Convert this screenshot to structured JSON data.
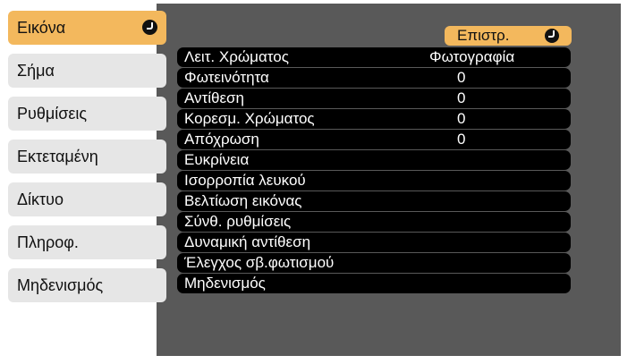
{
  "sidebar": {
    "items": [
      {
        "label": "Εικόνα",
        "active": true
      },
      {
        "label": "Σήμα"
      },
      {
        "label": "Ρυθμίσεις"
      },
      {
        "label": "Εκτεταμένη"
      },
      {
        "label": "Δίκτυο"
      },
      {
        "label": "Πληροφ."
      },
      {
        "label": "Μηδενισμός"
      }
    ]
  },
  "header": {
    "back_label": "Επιστρ."
  },
  "menu": {
    "items": [
      {
        "label": "Λειτ. Χρώματος",
        "value": "Φωτογραφία"
      },
      {
        "label": "Φωτεινότητα",
        "value": "0"
      },
      {
        "label": "Αντίθεση",
        "value": "0"
      },
      {
        "label": "Κορεσμ. Χρώματος",
        "value": "0"
      },
      {
        "label": "Απόχρωση",
        "value": "0"
      },
      {
        "label": "Ευκρίνεια"
      },
      {
        "label": "Ισορροπία λευκού"
      },
      {
        "label": "Βελτίωση εικόνας"
      },
      {
        "label": "Σύνθ. ρυθμίσεις"
      },
      {
        "label": "Δυναμική αντίθεση"
      },
      {
        "label": "Έλεγχος σβ.φωτισμού"
      },
      {
        "label": "Μηδενισμός"
      }
    ]
  },
  "colors": {
    "accent": "#f3b85d",
    "panel": "#595959",
    "tab": "#e6e6e6",
    "row": "#000000"
  },
  "icons": {
    "enter": "enter-icon"
  }
}
